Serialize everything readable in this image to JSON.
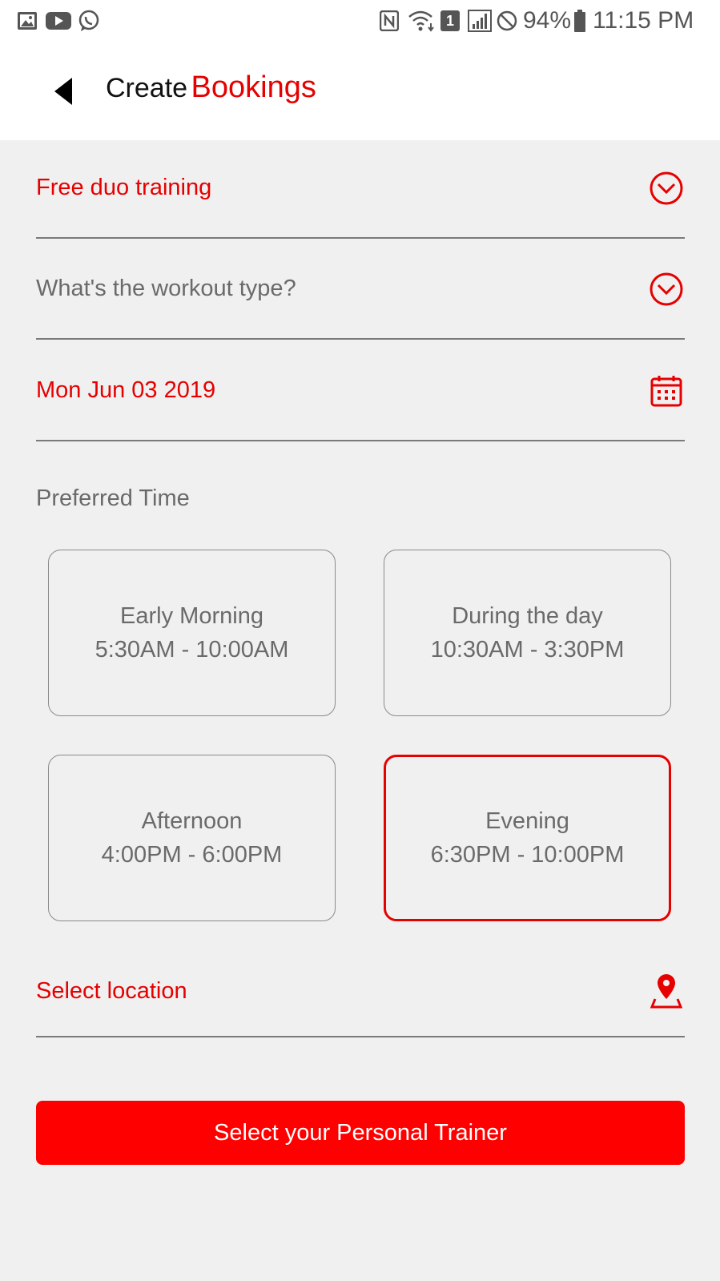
{
  "status_bar": {
    "left_icons": [
      "image-icon",
      "youtube-icon",
      "whatsapp-icon"
    ],
    "right_icons": [
      "nfc-icon",
      "wifi-icon",
      "sim1-icon",
      "signal-icon",
      "do-not-disturb-icon",
      "battery-icon"
    ],
    "sim_label": "1",
    "battery": "94%",
    "time": "11:15 PM"
  },
  "header": {
    "title_main": "Create",
    "title_accent": "Bookings",
    "back_icon": "back-arrow-icon"
  },
  "form": {
    "package": {
      "value": "Free duo training",
      "icon": "chevron-down-circle-icon"
    },
    "workout_type": {
      "placeholder": "What's the workout type?",
      "icon": "chevron-down-circle-icon"
    },
    "date": {
      "value": "Mon Jun 03 2019",
      "icon": "calendar-icon"
    },
    "preferred_time": {
      "label": "Preferred Time",
      "options": [
        {
          "name": "Early Morning",
          "range": "5:30AM - 10:00AM",
          "selected": false
        },
        {
          "name": "During the day",
          "range": "10:30AM - 3:30PM",
          "selected": false
        },
        {
          "name": "Afternoon",
          "range": "4:00PM - 6:00PM",
          "selected": false
        },
        {
          "name": "Evening",
          "range": "6:30PM - 10:00PM",
          "selected": true
        }
      ]
    },
    "location": {
      "value": "Select location",
      "icon": "location-pin-icon"
    }
  },
  "submit": {
    "label": "Select your Personal Trainer"
  },
  "colors": {
    "accent": "#e60000",
    "button": "#ff0000",
    "background": "#f0f0f0",
    "muted_text": "#6a6a6a"
  }
}
